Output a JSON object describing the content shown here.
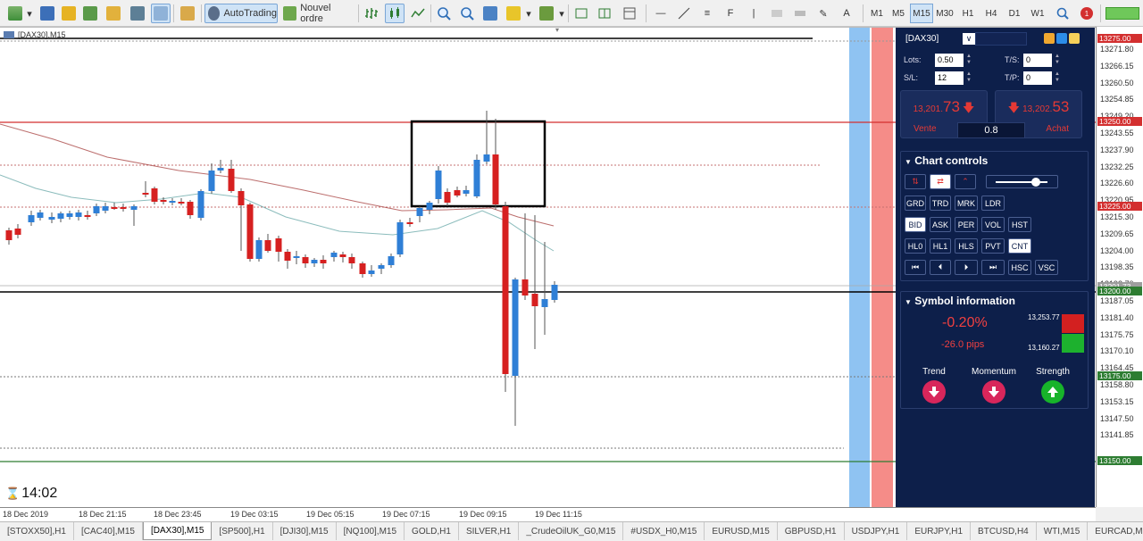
{
  "toolbar": {
    "autotrading_label": "AutoTrading",
    "new_order_label": "Nouvel ordre",
    "timeframes": [
      "M1",
      "M5",
      "M15",
      "M30",
      "H1",
      "H4",
      "D1",
      "W1"
    ],
    "active_timeframe": "M15",
    "notification_count": "1"
  },
  "chart": {
    "title": "[DAX30],M15",
    "countdown": "14:02",
    "price_ticks": [
      "13271.80",
      "13266.15",
      "13260.50",
      "13254.85",
      "13249.20",
      "13243.55",
      "13237.90",
      "13232.25",
      "13226.60",
      "13220.95",
      "13215.30",
      "13209.65",
      "13204.00",
      "13198.35",
      "13192.70",
      "13187.05",
      "13181.40",
      "13175.75",
      "13170.10",
      "13164.45",
      "13158.80",
      "13153.15",
      "13147.50",
      "13141.85"
    ],
    "price_tags": [
      {
        "label": "13275.00",
        "color": "#d32f2f"
      },
      {
        "label": "13250.00",
        "color": "#d32f2f"
      },
      {
        "label": "13225.00",
        "color": "#d32f2f"
      },
      {
        "label": "13201.73",
        "color": "#9e9e9e"
      },
      {
        "label": "13200.00",
        "color": "#2e7d32"
      },
      {
        "label": "13175.00",
        "color": "#2e7d32"
      },
      {
        "label": "13150.00",
        "color": "#2e7d32"
      }
    ],
    "time_ticks": [
      "18 Dec 2019",
      "18 Dec 21:15",
      "18 Dec 23:45",
      "19 Dec 03:15",
      "19 Dec 05:15",
      "19 Dec 07:15",
      "19 Dec 09:15",
      "19 Dec 11:15"
    ]
  },
  "panel": {
    "symbol": "[DAX30]",
    "lots_label": "Lots:",
    "lots_value": "0.50",
    "sl_label": "S/L:",
    "sl_value": "12",
    "ts_label": "T/S:",
    "ts_value": "0",
    "tp_label": "T/P:",
    "tp_value": "0",
    "sell_price_small": "13,201.",
    "sell_price_big": "73",
    "sell_label": "Vente",
    "buy_price_small": "13,202.",
    "buy_price_big": "53",
    "buy_label": "Achat",
    "spread": "0.8",
    "chart_controls_title": "Chart controls",
    "row1": [
      "GRD",
      "TRD",
      "MRK",
      "LDR"
    ],
    "row2": [
      "BID",
      "ASK",
      "PER",
      "VOL",
      "HST"
    ],
    "row3": [
      "HL0",
      "HL1",
      "HLS",
      "PVT",
      "CNT"
    ],
    "row4_tail": [
      "HSC",
      "VSC"
    ],
    "symbol_info_title": "Symbol information",
    "change_pct": "-0.20%",
    "change_pips": "-26.0 pips",
    "high": "13,253.77",
    "low": "13,160.27",
    "trend_label": "Trend",
    "momentum_label": "Momentum",
    "strength_label": "Strength"
  },
  "tabs": [
    "[STOXX50],H1",
    "[CAC40],M15",
    "[DAX30],M15",
    "[SP500],H1",
    "[DJI30],M15",
    "[NQ100],M15",
    "GOLD,H1",
    "SILVER,H1",
    "_CrudeOilUK_G0,M15",
    "#USDX_H0,M15",
    "EURUSD,M15",
    "GBPUSD,H1",
    "USDJPY,H1",
    "EURJPY,H1",
    "BTCUSD,H4",
    "WTI,M15",
    "EURCAD,M"
  ],
  "active_tab": "[DAX30],M15",
  "colors": {
    "bull": "#2f7fd6",
    "bear": "#d62020",
    "panel_bg": "#0d1f4a",
    "up_arrow": "#17b32a",
    "down_arrow": "#d8265b"
  }
}
